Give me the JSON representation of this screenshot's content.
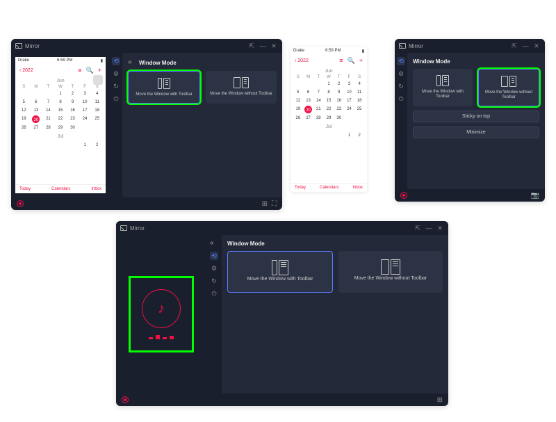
{
  "app": {
    "title": "Mirror"
  },
  "winbtns": {
    "pin": "⇱",
    "min": "—",
    "close": "✕"
  },
  "phone": {
    "status_left": "Drake",
    "status_time": "6:59 PM",
    "back": "‹ 2022",
    "month_label": "Jun",
    "next_month_label": "Jul",
    "days": [
      "S",
      "M",
      "T",
      "W",
      "T",
      "F",
      "S"
    ],
    "week1": [
      "",
      "",
      "",
      "1",
      "2",
      "3",
      "4"
    ],
    "week2": [
      "5",
      "6",
      "7",
      "8",
      "9",
      "10",
      "11"
    ],
    "week3": [
      "12",
      "13",
      "14",
      "15",
      "16",
      "17",
      "18"
    ],
    "week4": [
      "19",
      "20",
      "21",
      "22",
      "23",
      "24",
      "25"
    ],
    "week5": [
      "26",
      "27",
      "28",
      "29",
      "30",
      "",
      ""
    ],
    "jul_week": [
      "",
      "",
      "",
      "",
      "",
      "1",
      "2"
    ],
    "today": "20",
    "foot_left": "Today",
    "foot_center": "Calendars",
    "foot_right": "Inbox"
  },
  "panel": {
    "title": "Window Mode",
    "card_with": "Move the Window\nwith Toolbar",
    "card_without": "Move the Window\nwithout Toolbar",
    "sticky": "Sticky on top",
    "minimize": "Minimize"
  },
  "toolbar_icons": [
    "link-icon",
    "settings-icon",
    "history-icon",
    "power-icon"
  ]
}
